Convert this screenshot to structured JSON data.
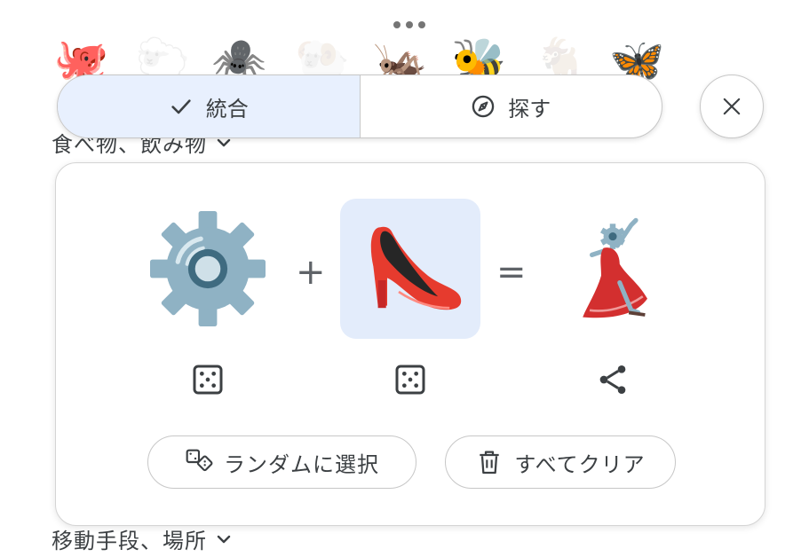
{
  "top_strip": {
    "emojis": [
      "🐙",
      "🐑",
      "🕷️",
      "🐏",
      "🦗",
      "🐝",
      "🐐",
      "🦋"
    ]
  },
  "categories": {
    "food_label": "食べ物、飲み物",
    "travel_label": "移動手段、場所"
  },
  "segmented": {
    "combine_label": "統合",
    "explore_label": "探す"
  },
  "mixer": {
    "left_emoji_name": "gear",
    "right_emoji_name": "high-heeled-shoe",
    "result_emoji_name": "gear-dancer",
    "plus": "+",
    "equals": "="
  },
  "actions": {
    "random_label": "ランダムに選択",
    "clear_label": "すべてクリア"
  },
  "colors": {
    "selected_bg": "#e8f0fe",
    "border": "#c7c7c7",
    "text": "#3c4043"
  }
}
